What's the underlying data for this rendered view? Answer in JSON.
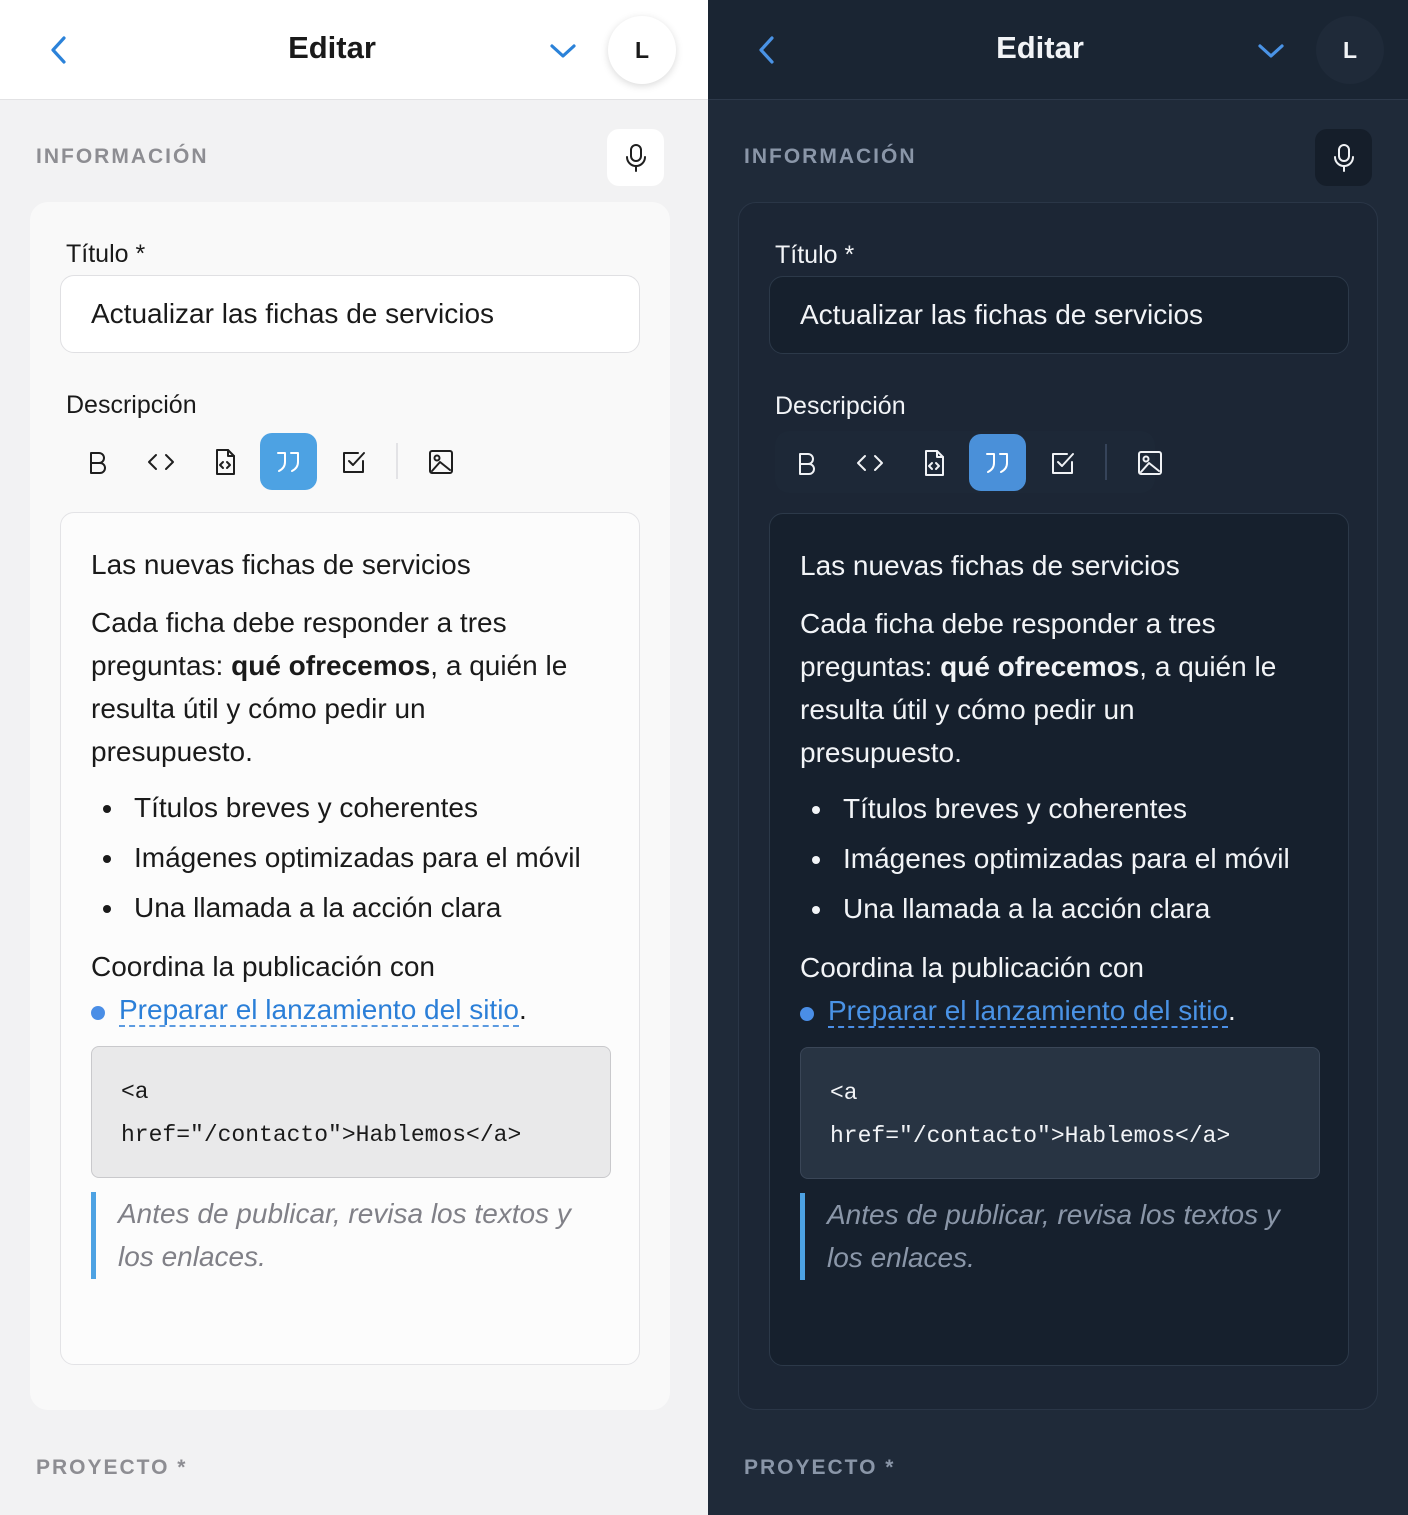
{
  "header": {
    "title": "Editar",
    "avatar_initial": "L"
  },
  "sections": {
    "info_label": "INFORMACIÓN",
    "project_label": "PROYECTO *"
  },
  "form": {
    "title_label": "Título *",
    "title_value": "Actualizar las fichas de servicios",
    "description_label": "Descripción"
  },
  "toolbar": {
    "buttons": [
      {
        "icon": "bold-icon",
        "active": false
      },
      {
        "icon": "code-icon",
        "active": false
      },
      {
        "icon": "code-file-icon",
        "active": false
      },
      {
        "icon": "quote-icon",
        "active": true
      },
      {
        "icon": "checkbox-icon",
        "active": false
      },
      {
        "icon": "image-icon",
        "active": false
      }
    ]
  },
  "editor": {
    "heading": "Las nuevas fichas de servicios",
    "para_line1": "Cada ficha debe responder a tres",
    "para_line2_pre": "preguntas: ",
    "para_line2_bold": "qué ofrecemos",
    "para_line2_post": ", a quién le",
    "para_line3": "resulta útil y cómo pedir un",
    "para_line4": "presupuesto.",
    "bullets": [
      "Títulos breves y coherentes",
      "Imágenes optimizadas para el móvil",
      "Una llamada a la acción clara"
    ],
    "coord_text": "Coordina la publicación con",
    "link_text": "Preparar el lanzamiento del sitio",
    "link_suffix": ".",
    "code_line1": "<a",
    "code_line2": "href=\"/contacto\">Hablemos</a>",
    "quote_line1": "Antes de publicar, revisa los textos y",
    "quote_line2": "los enlaces."
  },
  "colors": {
    "accent": "#4da2e3",
    "link": "#2b7fd8",
    "dark_background": "#1f2a39",
    "light_background": "#f2f2f3"
  }
}
